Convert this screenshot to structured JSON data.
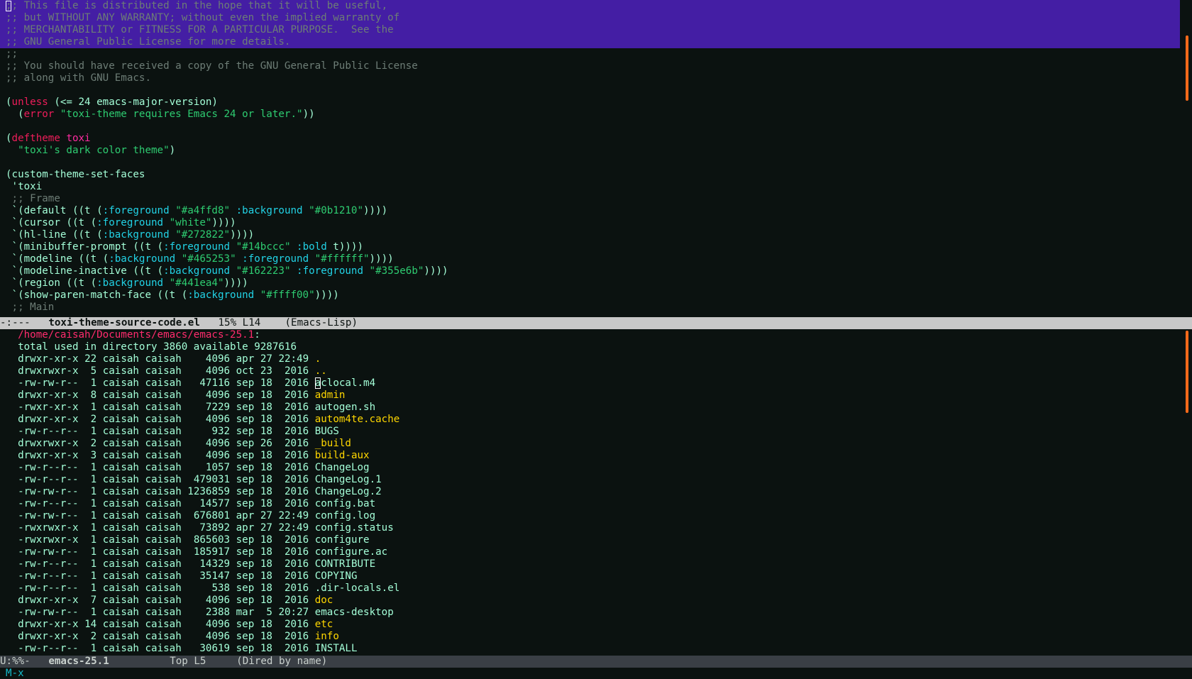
{
  "window": {
    "app": "Emacs",
    "colors": {
      "background": "#0b1210",
      "foreground": "#a4ffd8",
      "region": "#441ea4",
      "keyword": "#ee1d5a",
      "string": "#2ecc71",
      "constant": "#22d3e6",
      "directory": "#ffd700",
      "scrollbar": "#ff6a1a",
      "minibuffer_prompt": "#14bccc"
    }
  },
  "code_buffer": {
    "lines": [
      [
        {
          "t": ";; This file is distributed in the hope that it will be useful,",
          "c": "comment"
        }
      ],
      [
        {
          "t": ";; but WITHOUT ANY WARRANTY; without even the implied warranty of",
          "c": "comment"
        }
      ],
      [
        {
          "t": ";; MERCHANTABILITY or FITNESS FOR A PARTICULAR PURPOSE.  See the",
          "c": "comment"
        }
      ],
      [
        {
          "t": ";; GNU General Public License for more details.",
          "c": "comment"
        }
      ],
      [
        {
          "t": ";;",
          "c": "comment"
        }
      ],
      [
        {
          "t": ";; You should have received a copy of the GNU General Public License",
          "c": "comment"
        }
      ],
      [
        {
          "t": ";; along with GNU Emacs.",
          "c": "comment"
        }
      ],
      [],
      [
        {
          "t": "("
        },
        {
          "t": "unless",
          "c": "kw"
        },
        {
          "t": " (<= 24 emacs-major-version)"
        }
      ],
      [
        {
          "t": "  ("
        },
        {
          "t": "error",
          "c": "kw"
        },
        {
          "t": " "
        },
        {
          "t": "\"toxi-theme requires Emacs 24 or later.\"",
          "c": "str"
        },
        {
          "t": "))"
        }
      ],
      [],
      [
        {
          "t": "("
        },
        {
          "t": "deftheme",
          "c": "kw"
        },
        {
          "t": " "
        },
        {
          "t": "toxi",
          "c": "def"
        }
      ],
      [
        {
          "t": "  "
        },
        {
          "t": "\"toxi's dark color theme\"",
          "c": "str"
        },
        {
          "t": ")"
        }
      ],
      [],
      [
        {
          "t": "(custom-theme-set-faces"
        }
      ],
      [
        {
          "t": " 'toxi"
        }
      ],
      [
        {
          "t": " ;; Frame",
          "c": "comment"
        }
      ],
      [
        {
          "t": " `(default ((t ("
        },
        {
          "t": ":foreground",
          "c": "const"
        },
        {
          "t": " "
        },
        {
          "t": "\"#a4ffd8\"",
          "c": "str"
        },
        {
          "t": " "
        },
        {
          "t": ":background",
          "c": "const"
        },
        {
          "t": " "
        },
        {
          "t": "\"#0b1210\"",
          "c": "str"
        },
        {
          "t": "))))"
        }
      ],
      [
        {
          "t": " `(cursor ((t ("
        },
        {
          "t": ":foreground",
          "c": "const"
        },
        {
          "t": " "
        },
        {
          "t": "\"white\"",
          "c": "str"
        },
        {
          "t": "))))"
        }
      ],
      [
        {
          "t": " `(hl-line ((t ("
        },
        {
          "t": ":background",
          "c": "const"
        },
        {
          "t": " "
        },
        {
          "t": "\"#272822\"",
          "c": "str"
        },
        {
          "t": "))))"
        }
      ],
      [
        {
          "t": " `(minibuffer-prompt ((t ("
        },
        {
          "t": ":foreground",
          "c": "const"
        },
        {
          "t": " "
        },
        {
          "t": "\"#14bccc\"",
          "c": "str"
        },
        {
          "t": " "
        },
        {
          "t": ":bold",
          "c": "const"
        },
        {
          "t": " t))))"
        }
      ],
      [
        {
          "t": " `(modeline ((t ("
        },
        {
          "t": ":background",
          "c": "const"
        },
        {
          "t": " "
        },
        {
          "t": "\"#465253\"",
          "c": "str"
        },
        {
          "t": " "
        },
        {
          "t": ":foreground",
          "c": "const"
        },
        {
          "t": " "
        },
        {
          "t": "\"#ffffff\"",
          "c": "str"
        },
        {
          "t": "))))"
        }
      ],
      [
        {
          "t": " `(modeline-inactive ((t ("
        },
        {
          "t": ":background",
          "c": "const"
        },
        {
          "t": " "
        },
        {
          "t": "\"#162223\"",
          "c": "str"
        },
        {
          "t": " "
        },
        {
          "t": ":foreground",
          "c": "const"
        },
        {
          "t": " "
        },
        {
          "t": "\"#355e6b\"",
          "c": "str"
        },
        {
          "t": "))))"
        }
      ],
      [
        {
          "t": " `(region ((t ("
        },
        {
          "t": ":background",
          "c": "const"
        },
        {
          "t": " "
        },
        {
          "t": "\"#441ea4\"",
          "c": "str"
        },
        {
          "t": "))))"
        }
      ],
      [
        {
          "t": " `(show-paren-match-face ((t ("
        },
        {
          "t": ":background",
          "c": "const"
        },
        {
          "t": " "
        },
        {
          "t": "\"#ffff00\"",
          "c": "str"
        },
        {
          "t": "))))"
        }
      ],
      [
        {
          "t": " ;; Main",
          "c": "comment"
        }
      ]
    ],
    "region_lines": [
      0,
      1,
      2,
      3
    ]
  },
  "modeline_top": {
    "status": "-:---",
    "buffer_name": "toxi-theme-source-code.el",
    "position": "15% L14",
    "mode": "(Emacs-Lisp)"
  },
  "dired": {
    "header_path": "/home/caisah/Documents/emacs/emacs-25.1",
    "header_suffix": ":",
    "summary": "total used in directory 3860 available 9287616",
    "entries": [
      {
        "perm": "drwxr-xr-x",
        "links": "22",
        "owner": "caisah",
        "group": "caisah",
        "size": "4096",
        "month": "apr",
        "day": "27",
        "time": "22:49",
        "name": ".",
        "dir": true
      },
      {
        "perm": "drwxrwxr-x",
        "links": "5",
        "owner": "caisah",
        "group": "caisah",
        "size": "4096",
        "month": "oct",
        "day": "23",
        "time": "2016",
        "name": "..",
        "dir": true
      },
      {
        "perm": "-rw-rw-r--",
        "links": "1",
        "owner": "caisah",
        "group": "caisah",
        "size": "47116",
        "month": "sep",
        "day": "18",
        "time": "2016",
        "name": "aclocal.m4",
        "dir": false,
        "cursor": true
      },
      {
        "perm": "drwxr-xr-x",
        "links": "8",
        "owner": "caisah",
        "group": "caisah",
        "size": "4096",
        "month": "sep",
        "day": "18",
        "time": "2016",
        "name": "admin",
        "dir": true
      },
      {
        "perm": "-rwxr-xr-x",
        "links": "1",
        "owner": "caisah",
        "group": "caisah",
        "size": "7229",
        "month": "sep",
        "day": "18",
        "time": "2016",
        "name": "autogen.sh",
        "dir": false
      },
      {
        "perm": "drwxr-xr-x",
        "links": "2",
        "owner": "caisah",
        "group": "caisah",
        "size": "4096",
        "month": "sep",
        "day": "18",
        "time": "2016",
        "name": "autom4te.cache",
        "dir": true
      },
      {
        "perm": "-rw-r--r--",
        "links": "1",
        "owner": "caisah",
        "group": "caisah",
        "size": "932",
        "month": "sep",
        "day": "18",
        "time": "2016",
        "name": "BUGS",
        "dir": false
      },
      {
        "perm": "drwxrwxr-x",
        "links": "2",
        "owner": "caisah",
        "group": "caisah",
        "size": "4096",
        "month": "sep",
        "day": "26",
        "time": "2016",
        "name": "_build",
        "dir": true
      },
      {
        "perm": "drwxr-xr-x",
        "links": "3",
        "owner": "caisah",
        "group": "caisah",
        "size": "4096",
        "month": "sep",
        "day": "18",
        "time": "2016",
        "name": "build-aux",
        "dir": true
      },
      {
        "perm": "-rw-r--r--",
        "links": "1",
        "owner": "caisah",
        "group": "caisah",
        "size": "1057",
        "month": "sep",
        "day": "18",
        "time": "2016",
        "name": "ChangeLog",
        "dir": false
      },
      {
        "perm": "-rw-r--r--",
        "links": "1",
        "owner": "caisah",
        "group": "caisah",
        "size": "479031",
        "month": "sep",
        "day": "18",
        "time": "2016",
        "name": "ChangeLog.1",
        "dir": false
      },
      {
        "perm": "-rw-rw-r--",
        "links": "1",
        "owner": "caisah",
        "group": "caisah",
        "size": "1236859",
        "month": "sep",
        "day": "18",
        "time": "2016",
        "name": "ChangeLog.2",
        "dir": false
      },
      {
        "perm": "-rw-r--r--",
        "links": "1",
        "owner": "caisah",
        "group": "caisah",
        "size": "14577",
        "month": "sep",
        "day": "18",
        "time": "2016",
        "name": "config.bat",
        "dir": false
      },
      {
        "perm": "-rw-rw-r--",
        "links": "1",
        "owner": "caisah",
        "group": "caisah",
        "size": "676801",
        "month": "apr",
        "day": "27",
        "time": "22:49",
        "name": "config.log",
        "dir": false
      },
      {
        "perm": "-rwxrwxr-x",
        "links": "1",
        "owner": "caisah",
        "group": "caisah",
        "size": "73892",
        "month": "apr",
        "day": "27",
        "time": "22:49",
        "name": "config.status",
        "dir": false
      },
      {
        "perm": "-rwxrwxr-x",
        "links": "1",
        "owner": "caisah",
        "group": "caisah",
        "size": "865603",
        "month": "sep",
        "day": "18",
        "time": "2016",
        "name": "configure",
        "dir": false
      },
      {
        "perm": "-rw-rw-r--",
        "links": "1",
        "owner": "caisah",
        "group": "caisah",
        "size": "185917",
        "month": "sep",
        "day": "18",
        "time": "2016",
        "name": "configure.ac",
        "dir": false
      },
      {
        "perm": "-rw-r--r--",
        "links": "1",
        "owner": "caisah",
        "group": "caisah",
        "size": "14329",
        "month": "sep",
        "day": "18",
        "time": "2016",
        "name": "CONTRIBUTE",
        "dir": false
      },
      {
        "perm": "-rw-r--r--",
        "links": "1",
        "owner": "caisah",
        "group": "caisah",
        "size": "35147",
        "month": "sep",
        "day": "18",
        "time": "2016",
        "name": "COPYING",
        "dir": false
      },
      {
        "perm": "-rw-r--r--",
        "links": "1",
        "owner": "caisah",
        "group": "caisah",
        "size": "538",
        "month": "sep",
        "day": "18",
        "time": "2016",
        "name": ".dir-locals.el",
        "dir": false
      },
      {
        "perm": "drwxr-xr-x",
        "links": "7",
        "owner": "caisah",
        "group": "caisah",
        "size": "4096",
        "month": "sep",
        "day": "18",
        "time": "2016",
        "name": "doc",
        "dir": true
      },
      {
        "perm": "-rw-rw-r--",
        "links": "1",
        "owner": "caisah",
        "group": "caisah",
        "size": "2388",
        "month": "mar",
        "day": "5",
        "time": "20:27",
        "name": "emacs-desktop",
        "dir": false
      },
      {
        "perm": "drwxr-xr-x",
        "links": "14",
        "owner": "caisah",
        "group": "caisah",
        "size": "4096",
        "month": "sep",
        "day": "18",
        "time": "2016",
        "name": "etc",
        "dir": true
      },
      {
        "perm": "drwxr-xr-x",
        "links": "2",
        "owner": "caisah",
        "group": "caisah",
        "size": "4096",
        "month": "sep",
        "day": "18",
        "time": "2016",
        "name": "info",
        "dir": true
      },
      {
        "perm": "-rw-r--r--",
        "links": "1",
        "owner": "caisah",
        "group": "caisah",
        "size": "30619",
        "month": "sep",
        "day": "18",
        "time": "2016",
        "name": "INSTALL",
        "dir": false
      }
    ]
  },
  "modeline_bottom": {
    "status": "U:%%-",
    "buffer_name": "emacs-25.1",
    "position": "Top L5",
    "mode": "(Dired by name)"
  },
  "minibuffer": {
    "text": "M-x"
  }
}
